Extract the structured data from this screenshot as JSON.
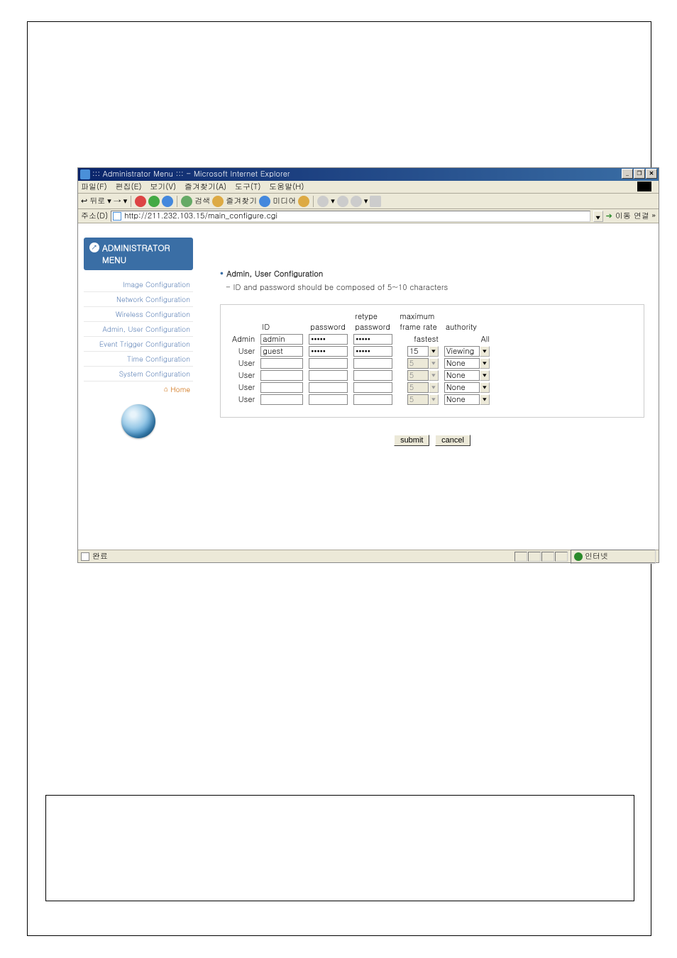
{
  "window": {
    "title": "::: Administrator Menu ::: - Microsoft Internet Explorer",
    "controls": {
      "min": "_",
      "max": "❐",
      "close": "✕"
    }
  },
  "menubar": {
    "file": "파일(F)",
    "edit": "편집(E)",
    "view": "보기(V)",
    "favorites": "즐겨찾기(A)",
    "tools": "도구(T)",
    "help": "도움말(H)"
  },
  "toolbar": {
    "back": "뒤로",
    "search": "검색",
    "favorites": "즐겨찾기",
    "media": "미디어"
  },
  "addressbar": {
    "label": "주소(D)",
    "url": "http://211.232.103.15/main_configure.cgi",
    "go": "이동",
    "links": "연결 »"
  },
  "sidebar": {
    "title_line1": "ADMINISTRATOR",
    "title_line2": "MENU",
    "items": [
      "Image Configuration",
      "Network Configuration",
      "Wireless Configuration",
      "Admin, User Configuration",
      "Event Trigger Configuration",
      "Time Configuration",
      "System Configuration"
    ],
    "home": "Home"
  },
  "main": {
    "title": "Admin, User Configuration",
    "note": "- ID and password should be composed of 5~10 characters",
    "headers": {
      "id": "ID",
      "password": "password",
      "retype1": "retype",
      "retype2": "password",
      "framerate1": "maximum",
      "framerate2": "frame rate",
      "authority": "authority"
    },
    "rows": [
      {
        "label": "Admin",
        "id": "admin",
        "pw": "*****",
        "rpw": "*****",
        "fr": "fastest",
        "fr_editable": false,
        "auth": "All",
        "auth_static": true
      },
      {
        "label": "User",
        "id": "guest",
        "pw": "*****",
        "rpw": "*****",
        "fr": "15",
        "fr_editable": true,
        "auth": "Viewing",
        "auth_static": false
      },
      {
        "label": "User",
        "id": "",
        "pw": "",
        "rpw": "",
        "fr": "5",
        "fr_editable": false,
        "auth": "None",
        "auth_static": false
      },
      {
        "label": "User",
        "id": "",
        "pw": "",
        "rpw": "",
        "fr": "5",
        "fr_editable": false,
        "auth": "None",
        "auth_static": false
      },
      {
        "label": "User",
        "id": "",
        "pw": "",
        "rpw": "",
        "fr": "5",
        "fr_editable": false,
        "auth": "None",
        "auth_static": false
      },
      {
        "label": "User",
        "id": "",
        "pw": "",
        "rpw": "",
        "fr": "5",
        "fr_editable": false,
        "auth": "None",
        "auth_static": false
      }
    ],
    "submit": "submit",
    "cancel": "cancel"
  },
  "statusbar": {
    "text": "완료",
    "zone": "인터넷"
  }
}
